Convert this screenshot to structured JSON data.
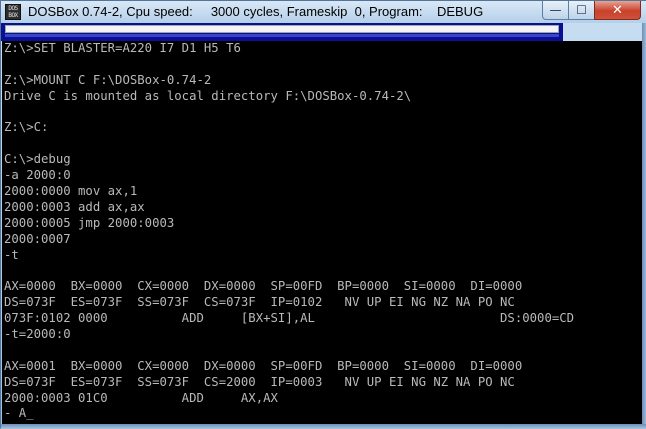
{
  "window": {
    "title": "DOSBox 0.74-2, Cpu speed:     3000 cycles, Frameskip  0, Program:    DEBUG",
    "icon_text": "DOS BOX",
    "minimize_glyph": "—",
    "maximize_glyph": "☐",
    "close_glyph": "✕"
  },
  "terminal": {
    "lines": [
      "Z:\\>SET BLASTER=A220 I7 D1 H5 T6",
      "",
      "Z:\\>MOUNT C F:\\DOSBox-0.74-2",
      "Drive C is mounted as local directory F:\\DOSBox-0.74-2\\",
      "",
      "Z:\\>C:",
      "",
      "C:\\>debug",
      "-a 2000:0",
      "2000:0000 mov ax,1",
      "2000:0003 add ax,ax",
      "2000:0005 jmp 2000:0003",
      "2000:0007",
      "-t",
      "",
      "AX=0000  BX=0000  CX=0000  DX=0000  SP=00FD  BP=0000  SI=0000  DI=0000",
      "DS=073F  ES=073F  SS=073F  CS=073F  IP=0102   NV UP EI NG NZ NA PO NC",
      "073F:0102 0000          ADD     [BX+SI],AL                         DS:0000=CD",
      "-t=2000:0",
      "",
      "AX=0001  BX=0000  CX=0000  DX=0000  SP=00FD  BP=0000  SI=0000  DI=0000",
      "DS=073F  ES=073F  SS=073F  CS=2000  IP=0003   NV UP EI NG NZ NA PO NC",
      "2000:0003 01C0          ADD     AX,AX",
      "- A_"
    ]
  }
}
